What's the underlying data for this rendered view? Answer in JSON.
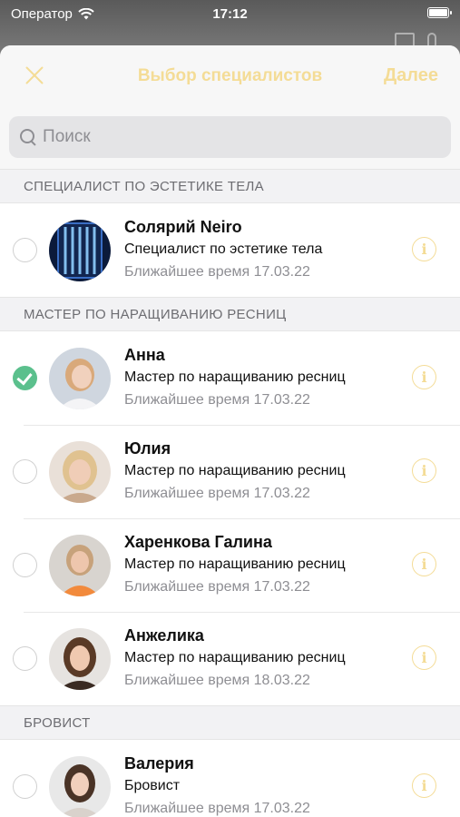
{
  "status": {
    "carrier": "Оператор",
    "time": "17:12"
  },
  "nav": {
    "title": "Выбор специалистов",
    "next_label": "Далее"
  },
  "search": {
    "placeholder": "Поиск"
  },
  "sections": [
    {
      "title": "СПЕЦИАЛИСТ ПО ЭСТЕТИКЕ ТЕЛА",
      "items": [
        {
          "name": "Солярий Neiro",
          "role": "Специалист по эстетике тела",
          "time": "Ближайшее время 17.03.22",
          "selected": false
        }
      ]
    },
    {
      "title": "МАСТЕР ПО НАРАЩИВАНИЮ РЕСНИЦ",
      "items": [
        {
          "name": "Анна",
          "role": "Мастер по наращиванию ресниц",
          "time": "Ближайшее время 17.03.22",
          "selected": true
        },
        {
          "name": "Юлия",
          "role": "Мастер по наращиванию ресниц",
          "time": "Ближайшее время 17.03.22",
          "selected": false
        },
        {
          "name": "Харенкова Галина",
          "role": "Мастер по наращиванию ресниц",
          "time": "Ближайшее время 17.03.22",
          "selected": false
        },
        {
          "name": "Анжелика",
          "role": "Мастер по наращиванию ресниц",
          "time": "Ближайшее время 18.03.22",
          "selected": false
        }
      ]
    },
    {
      "title": "БРОВИСТ",
      "items": [
        {
          "name": "Валерия",
          "role": "Бровист",
          "time": "Ближайшее время 17.03.22",
          "selected": false
        }
      ]
    }
  ],
  "colors": {
    "accent": "#f4dc96",
    "selected": "#5bc08d",
    "section_bg": "#f2f2f4"
  }
}
